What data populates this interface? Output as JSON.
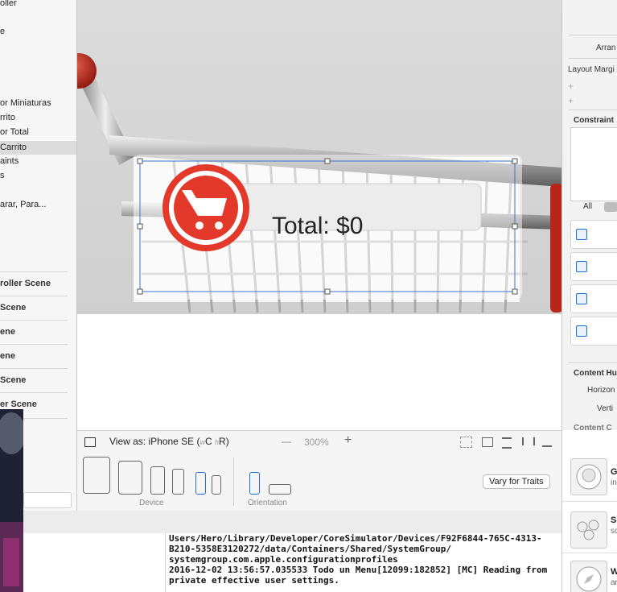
{
  "navigator": {
    "items": [
      {
        "label": "oller"
      },
      {
        "label": "e"
      },
      {
        "label": "or Miniaturas"
      },
      {
        "label": "rrito"
      },
      {
        "label": "or Total"
      },
      {
        "label": " Carrito"
      },
      {
        "label": "aints"
      },
      {
        "label": "s"
      },
      {
        "label": "arar, Para..."
      }
    ],
    "scenes": [
      {
        "label": "roller Scene"
      },
      {
        "label": "Scene"
      },
      {
        "label": "ene"
      },
      {
        "label": "ene"
      },
      {
        "label": "Scene"
      },
      {
        "label": "er Scene"
      }
    ]
  },
  "canvas": {
    "total_label": "Total: $0"
  },
  "viewas": {
    "label": "View as: iPhone SE (",
    "w": "w",
    "c": "C ",
    "h": "h",
    "r": "R)",
    "zoom_minus": "—",
    "zoom": "300%",
    "zoom_plus": "+"
  },
  "devices": {
    "device_label": "Device",
    "orientation_label": "Orientation",
    "vary_button": "Vary for Traits"
  },
  "console": {
    "lines": [
      "Users/Hero/Library/Developer/CoreSimulator/Devices/F92F6844-765C-4313-",
      "B210-5358E3120272/data/Containers/Shared/SystemGroup/",
      "systemgroup.com.apple.configurationprofiles",
      "2016-12-02 13:56:57.035533 Todo un Menu[12099:182852] [MC] Reading from",
      "private effective user settings."
    ]
  },
  "inspector": {
    "arrange": "Arran",
    "layout_margins": "Layout Margi",
    "plus1": "+",
    "plus2": "+",
    "constraints": "Constraint",
    "all_tab": "All",
    "content_hugging": "Content Hu",
    "horizontal": "Horizon",
    "vertical": "Verti",
    "content_c": "Content C"
  },
  "library": {
    "items": [
      {
        "title": "G",
        "sub": "in"
      },
      {
        "title": "S",
        "sub": "sc"
      },
      {
        "title": "W",
        "sub": "ar"
      }
    ]
  },
  "colors": {
    "accent": "#1a6fd1",
    "cart_red": "#e2392b",
    "selection": "#dcdcdc"
  }
}
